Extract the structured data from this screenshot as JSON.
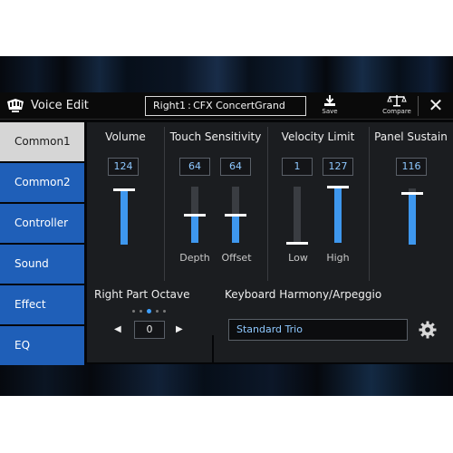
{
  "header": {
    "title": "Voice Edit",
    "voice_name": "Right1 : CFX ConcertGrand",
    "save_label": "Save",
    "compare_label": "Compare",
    "close_glyph": "✕"
  },
  "sidebar": {
    "items": [
      {
        "label": "Common1",
        "active": true
      },
      {
        "label": "Common2",
        "active": false
      },
      {
        "label": "Controller",
        "active": false
      },
      {
        "label": "Sound",
        "active": false
      },
      {
        "label": "Effect",
        "active": false
      },
      {
        "label": "EQ",
        "active": false
      }
    ]
  },
  "params": {
    "volume": {
      "title": "Volume",
      "value": "124",
      "level": 0.98
    },
    "touch": {
      "title": "Touch Sensitivity",
      "depth": {
        "label": "Depth",
        "value": "64",
        "level": 0.5
      },
      "offset": {
        "label": "Offset",
        "value": "64",
        "level": 0.5
      }
    },
    "velocity": {
      "title": "Velocity Limit",
      "low": {
        "label": "Low",
        "value": "1",
        "level": 0.0
      },
      "high": {
        "label": "High",
        "value": "127",
        "level": 1.0
      }
    },
    "sustain": {
      "title": "Panel Sustain",
      "value": "116",
      "level": 0.92
    }
  },
  "octave": {
    "title": "Right Part Octave",
    "value": "0",
    "left_arrow": "◀",
    "right_arrow": "▶",
    "dots_total": 5,
    "dot_active_index": 2
  },
  "harmony": {
    "title": "Keyboard Harmony/Arpeggio",
    "value": "Standard Trio"
  },
  "colors": {
    "accent": "#3e97ee",
    "sidebar": "#1f5fb8",
    "sidebar_active": "#d6d6d6",
    "panel": "#1b1d20",
    "value_text": "#8ec8ff"
  }
}
